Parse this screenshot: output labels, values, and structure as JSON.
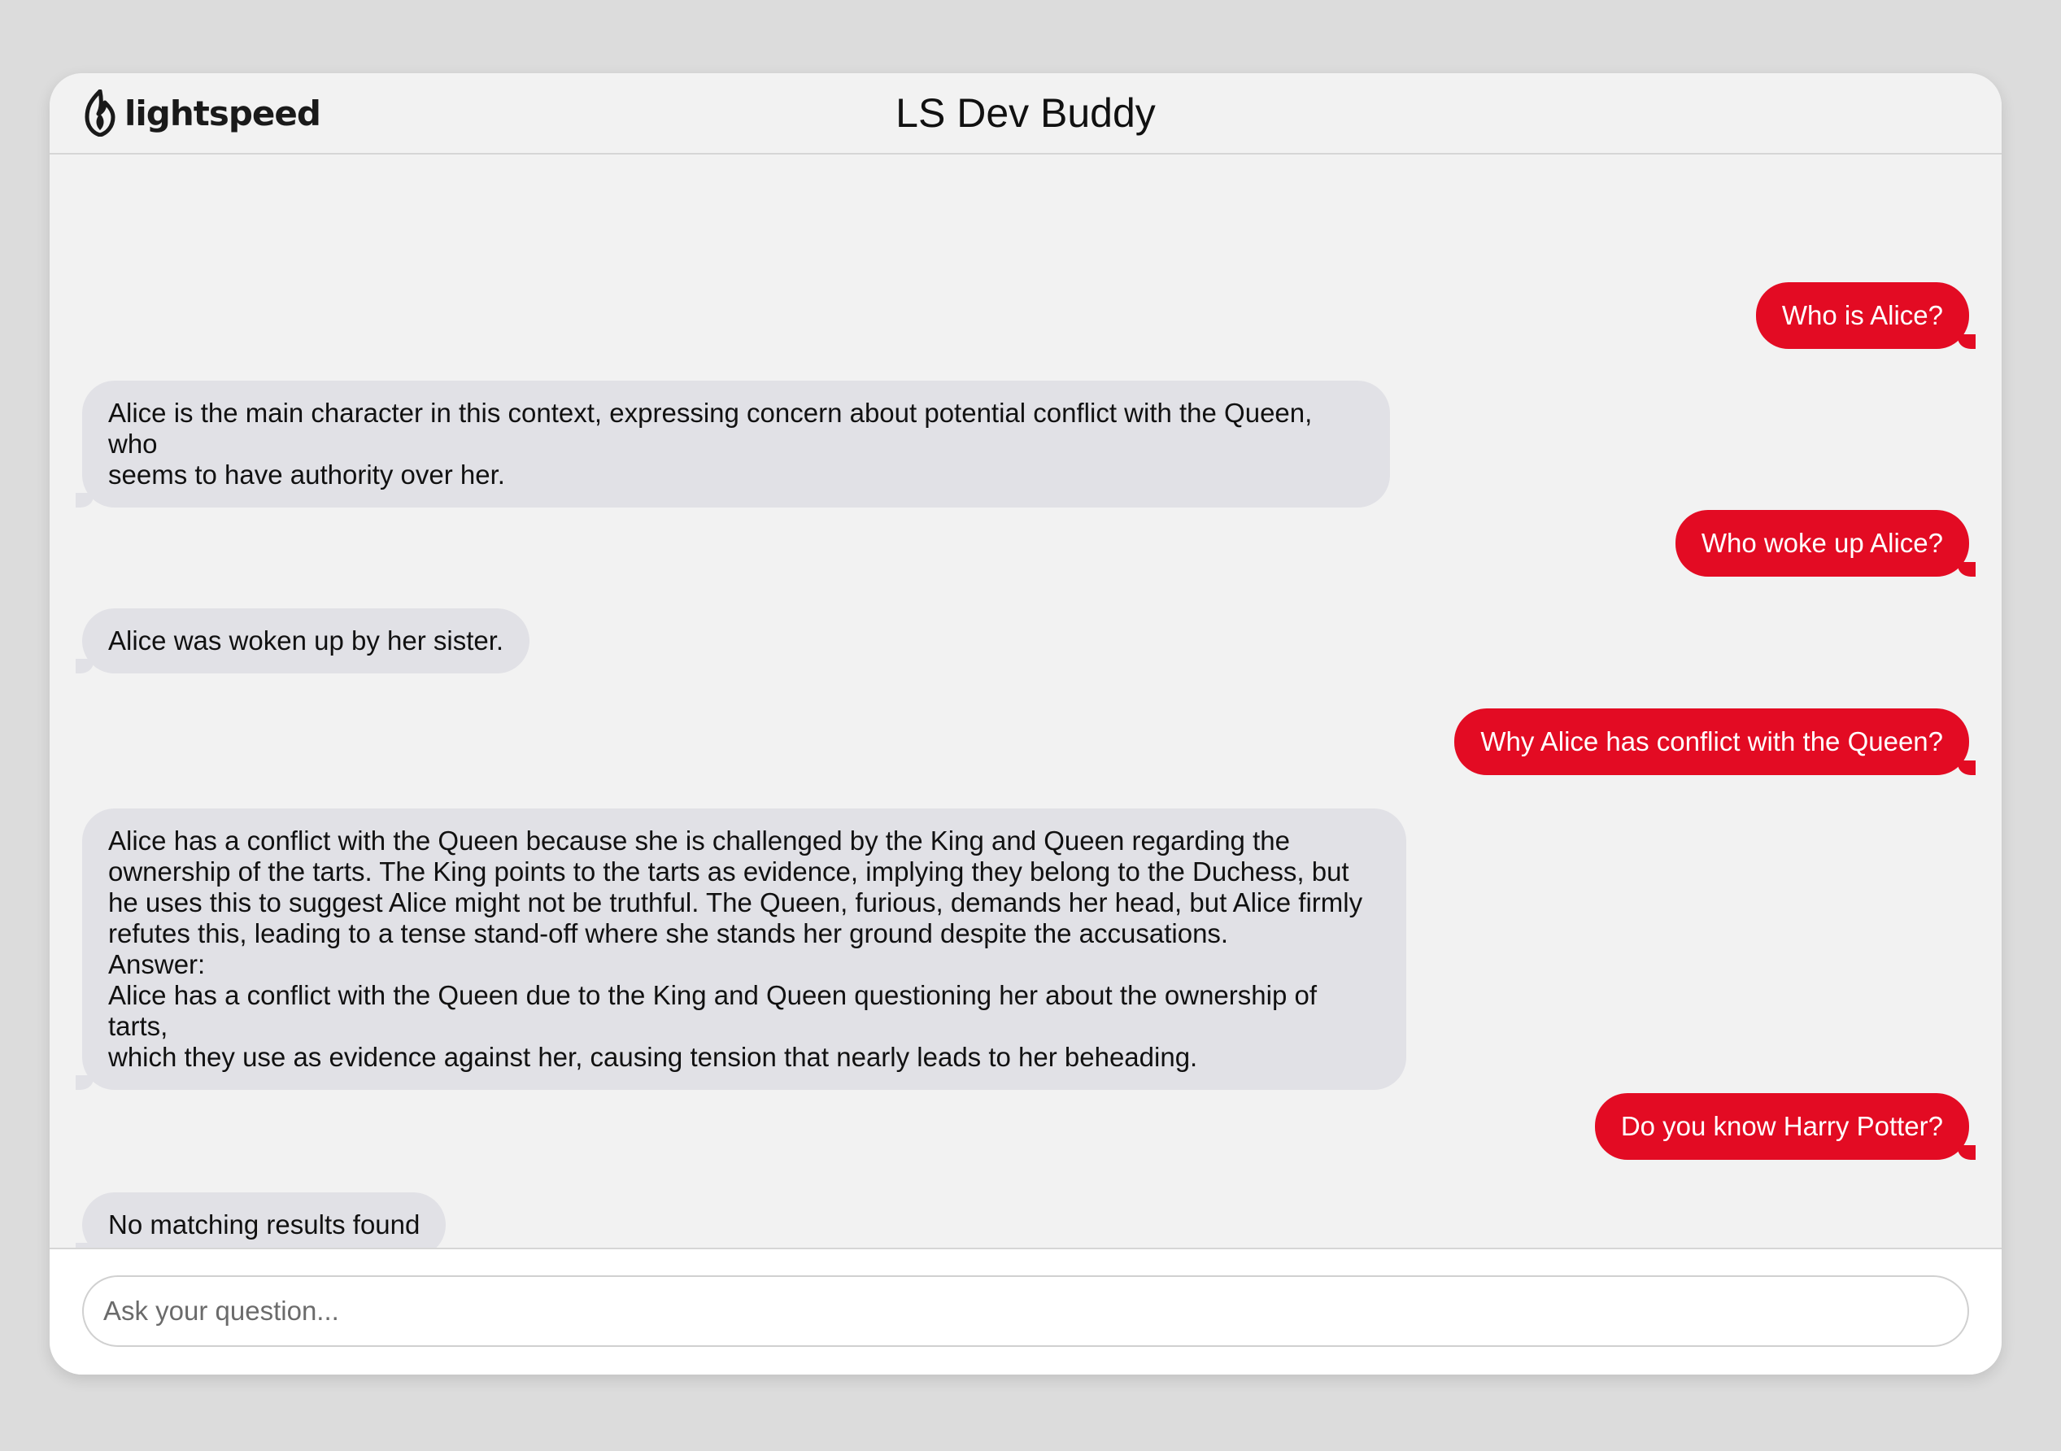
{
  "header": {
    "logo_text": "lightspeed",
    "title": "LS Dev Buddy"
  },
  "messages": [
    {
      "role": "user",
      "text": "Who is Alice?"
    },
    {
      "role": "bot",
      "text": "Alice is the main character in this context, expressing concern about potential conflict with the Queen, who\nseems to have authority over her."
    },
    {
      "role": "user",
      "text": "Who woke up Alice?"
    },
    {
      "role": "bot",
      "text": "Alice was woken up by her sister."
    },
    {
      "role": "user",
      "text": "Why Alice has conflict with the Queen?"
    },
    {
      "role": "bot",
      "text": "Alice has a conflict with the Queen because she is challenged by the King and Queen regarding the\nownership of the tarts. The King points to the tarts as evidence, implying they belong to the Duchess, but\nhe uses this to suggest Alice might not be truthful. The Queen, furious, demands her head, but Alice firmly\nrefutes this, leading to a tense stand-off where she stands her ground despite the accusations.\nAnswer:\nAlice has a conflict with the Queen due to the King and Queen questioning her about the ownership of tarts,\nwhich they use as evidence against her, causing tension that nearly leads to her beheading."
    },
    {
      "role": "user",
      "text": "Do you know Harry Potter?"
    },
    {
      "role": "bot",
      "text": "No matching results found"
    }
  ],
  "input": {
    "placeholder": "Ask your question...",
    "value": ""
  },
  "colors": {
    "user_bubble": "#e30b23",
    "bot_bubble": "#e1e1e6",
    "background": "#f2f2f2"
  },
  "icons": {
    "logo": "lightspeed-flame-icon"
  }
}
